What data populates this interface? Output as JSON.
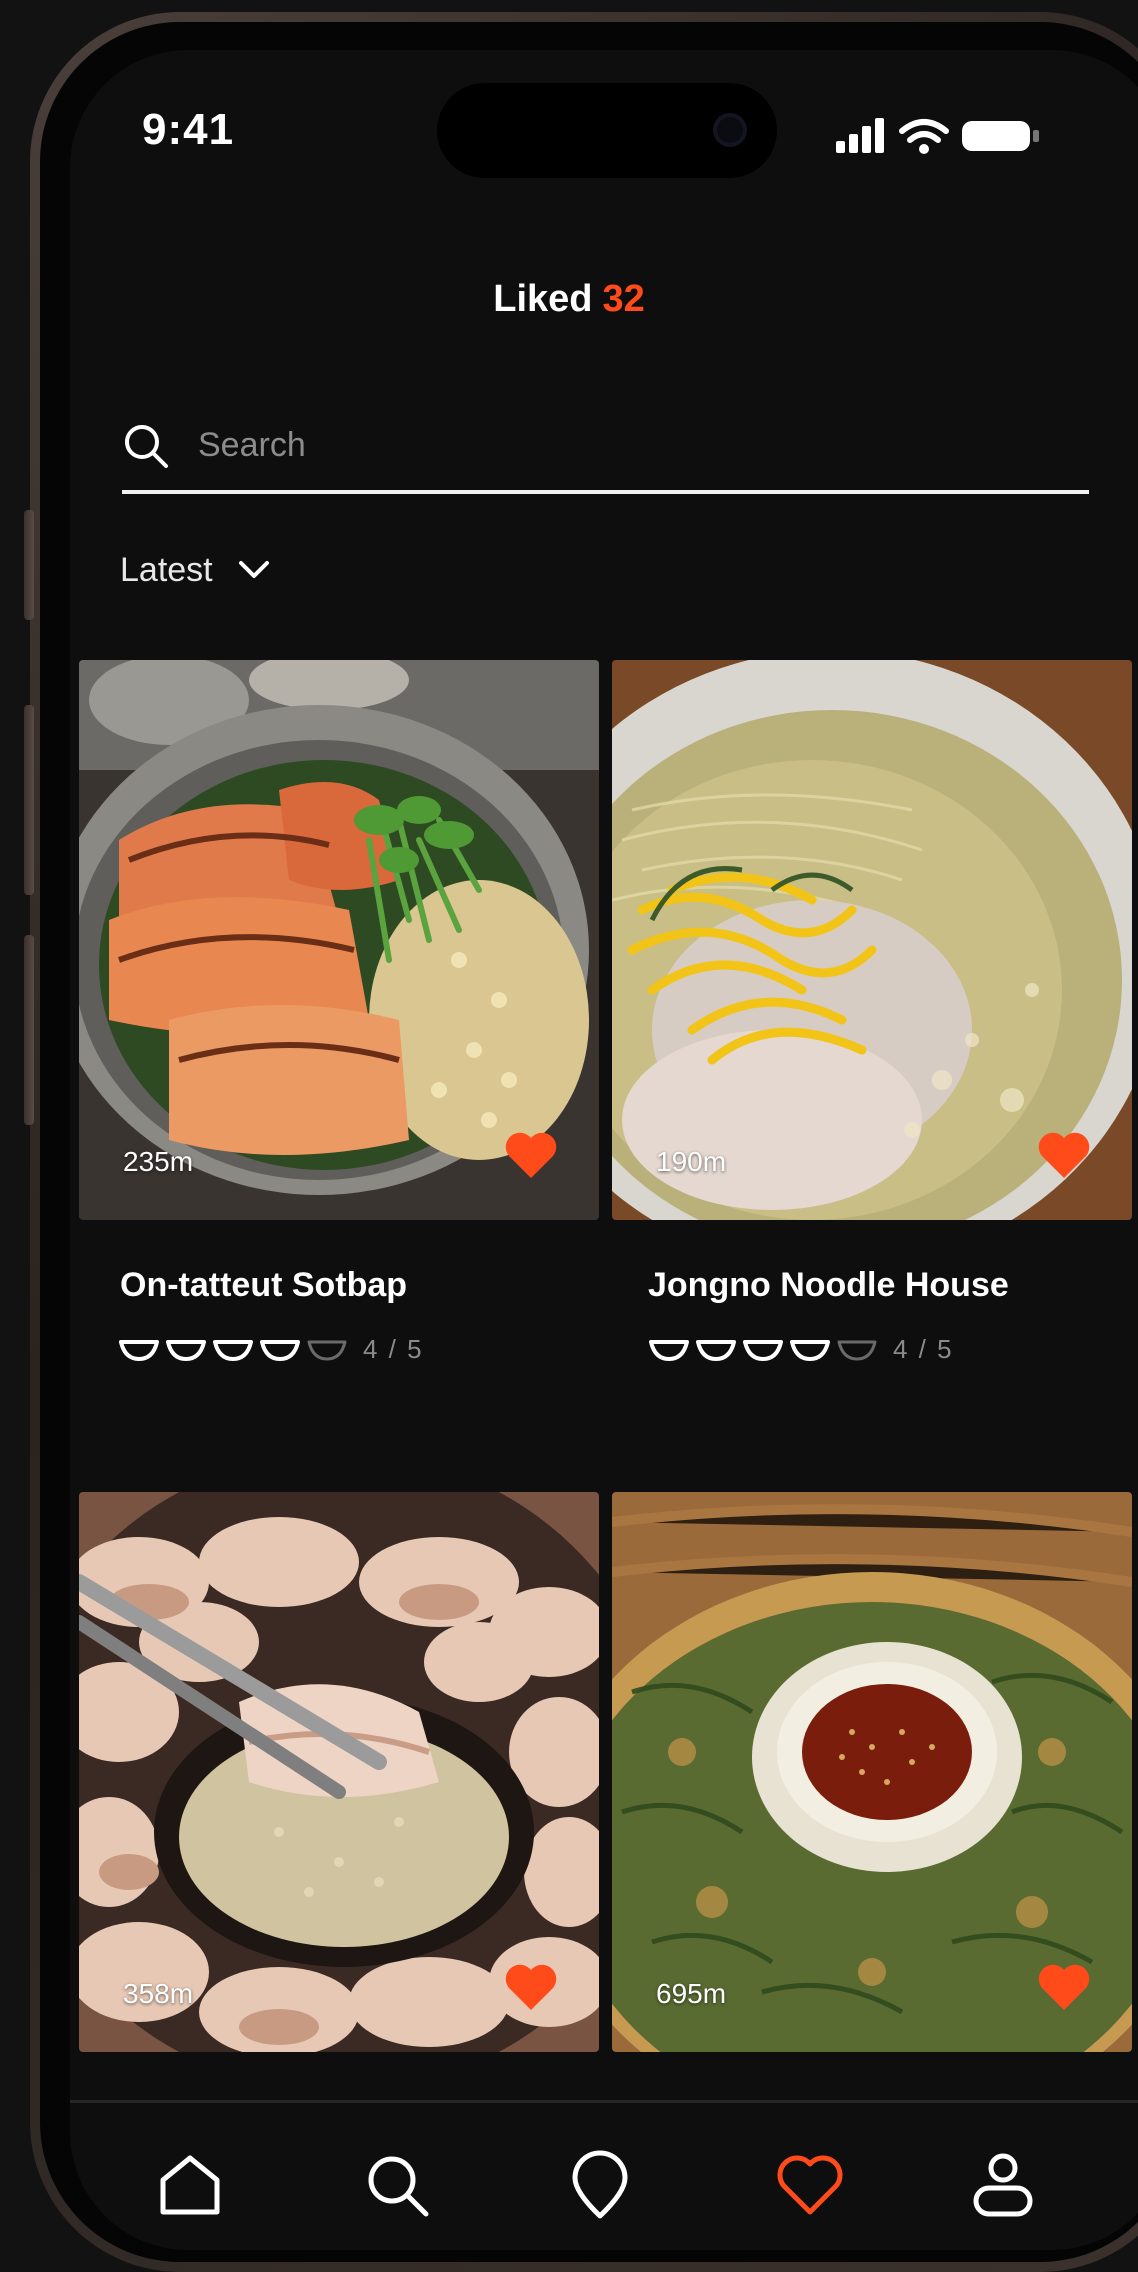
{
  "status_bar": {
    "time": "9:41"
  },
  "header": {
    "title": "Liked",
    "count": "32"
  },
  "search": {
    "placeholder": "Search",
    "value": ""
  },
  "sort": {
    "label": "Latest"
  },
  "colors": {
    "accent": "#ff4a1a",
    "background": "#0e0e0e",
    "text": "#ffffff",
    "muted": "#8a8a8a"
  },
  "places": [
    {
      "name": "On-tatteut Sotbap",
      "distance": "235m",
      "rating": 4,
      "rating_max": 5,
      "rating_text": "4 / 5",
      "liked": true,
      "photo": "salmon-rice-pot"
    },
    {
      "name": "Jongno Noodle House",
      "distance": "190m",
      "rating": 4,
      "rating_max": 5,
      "rating_text": "4 / 5",
      "liked": true,
      "photo": "cold-noodle-soup"
    },
    {
      "name": "",
      "distance": "358m",
      "liked": true,
      "photo": "boiled-pork-bossam"
    },
    {
      "name": "",
      "distance": "695m",
      "liked": true,
      "photo": "green-onion-pancake"
    }
  ],
  "nav": [
    {
      "name": "home",
      "icon": "home-icon",
      "active": false
    },
    {
      "name": "search",
      "icon": "search-icon",
      "active": false
    },
    {
      "name": "map",
      "icon": "location-pin-icon",
      "active": false
    },
    {
      "name": "liked",
      "icon": "heart-icon",
      "active": true
    },
    {
      "name": "profile",
      "icon": "profile-icon",
      "active": false
    }
  ]
}
